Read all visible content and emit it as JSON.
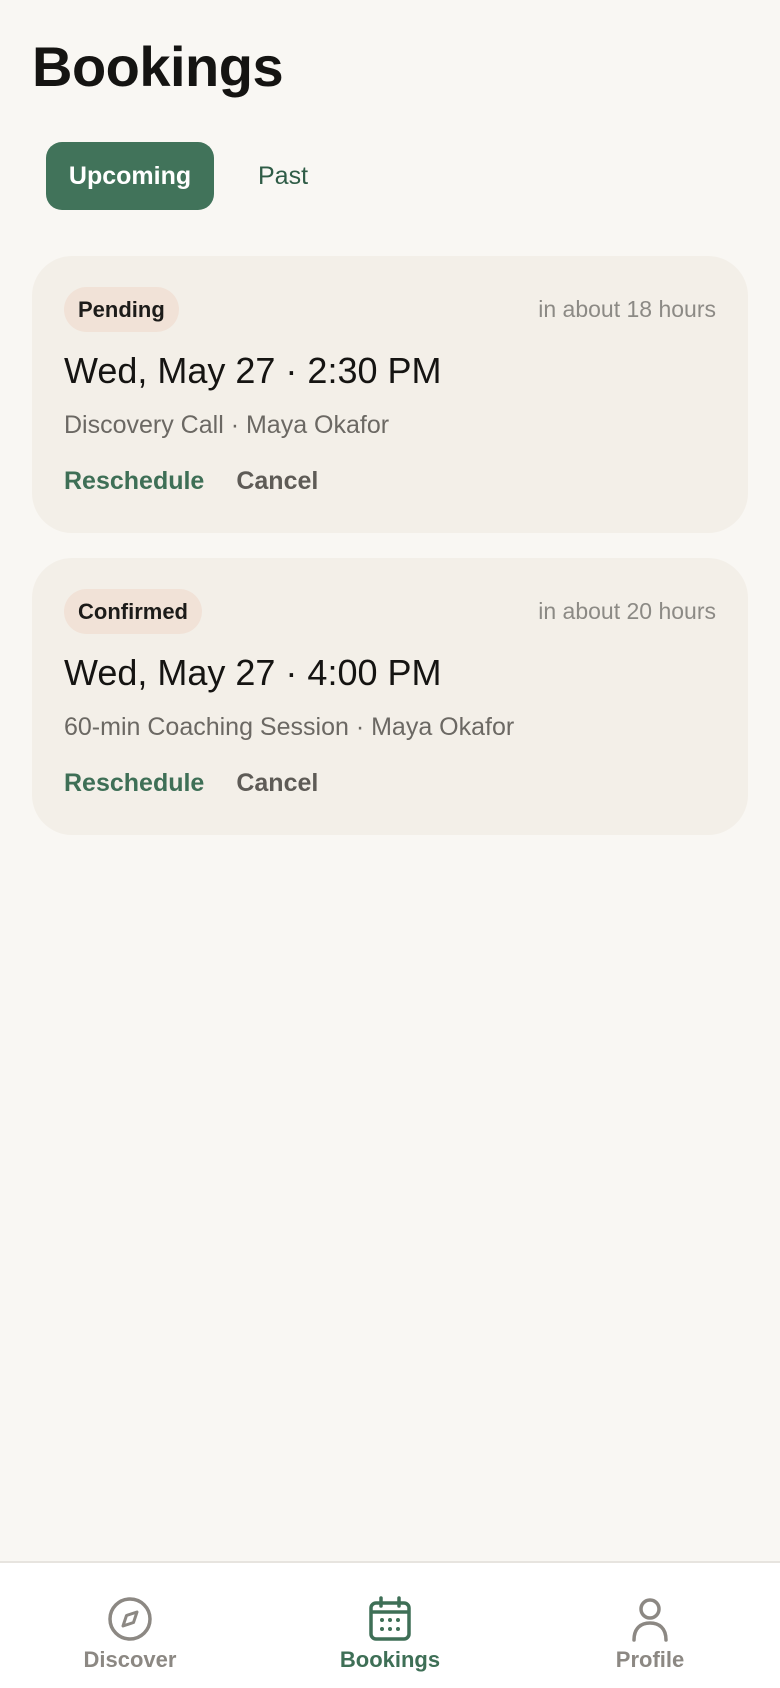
{
  "header": {
    "title": "Bookings"
  },
  "tabs": [
    {
      "label": "Upcoming",
      "active": true
    },
    {
      "label": "Past",
      "active": false
    }
  ],
  "bookings": [
    {
      "status": "Pending",
      "relative_time": "in about 18 hours",
      "datetime": "Wed, May 27 · 2:30 PM",
      "subtitle": "Discovery Call · Maya Okafor",
      "reschedule_label": "Reschedule",
      "cancel_label": "Cancel"
    },
    {
      "status": "Confirmed",
      "relative_time": "in about 20 hours",
      "datetime": "Wed, May 27 · 4:00 PM",
      "subtitle": "60-min Coaching Session · Maya Okafor",
      "reschedule_label": "Reschedule",
      "cancel_label": "Cancel"
    }
  ],
  "bottom_nav": {
    "items": [
      {
        "label": "Discover",
        "icon": "compass-icon",
        "active": false
      },
      {
        "label": "Bookings",
        "icon": "calendar-icon",
        "active": true
      },
      {
        "label": "Profile",
        "icon": "person-icon",
        "active": false
      }
    ]
  },
  "colors": {
    "background": "#f9f7f3",
    "accent": "#41735a",
    "card": "#f3efe8",
    "badge": "#f1e2d7",
    "nav_inactive": "#8c8883"
  }
}
